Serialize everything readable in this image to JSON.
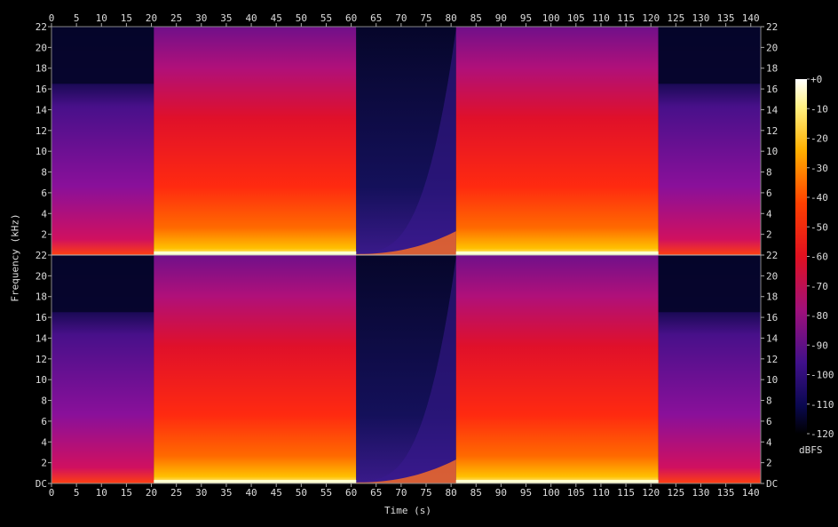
{
  "chart_data": {
    "type": "heatmap",
    "title": "",
    "xlabel": "Time (s)",
    "ylabel": "Frequency (kHz)",
    "xlim": [
      0,
      142
    ],
    "ylim": [
      0,
      22
    ],
    "x_ticks": [
      "0",
      "5",
      "10",
      "15",
      "20",
      "25",
      "30",
      "35",
      "40",
      "45",
      "50",
      "55",
      "60",
      "65",
      "70",
      "75",
      "80",
      "85",
      "90",
      "95",
      "100",
      "105",
      "110",
      "115",
      "120",
      "125",
      "130",
      "135",
      "140"
    ],
    "y_ticks_top": [
      "2",
      "4",
      "6",
      "8",
      "10",
      "12",
      "14",
      "16",
      "18",
      "20",
      "22"
    ],
    "y_ticks_bottom": [
      "DC",
      "2",
      "4",
      "6",
      "8",
      "10",
      "12",
      "14",
      "16",
      "18",
      "20",
      "22"
    ],
    "channels": 2,
    "colorbar": {
      "unit": "dBFS",
      "range": [
        -120,
        0
      ],
      "ticks": [
        "+0",
        "-10",
        "-20",
        "-30",
        "-40",
        "-50",
        "-60",
        "-70",
        "-80",
        "-90",
        "-100",
        "-110",
        "-120"
      ]
    },
    "segments": [
      {
        "start": 0,
        "end": 20.5,
        "character": "quiet, lowpass ~16.5 kHz"
      },
      {
        "start": 20.5,
        "end": 61,
        "character": "loud, full band"
      },
      {
        "start": 61,
        "end": 81,
        "character": "rising sweep, quiet"
      },
      {
        "start": 81,
        "end": 121.5,
        "character": "loud, full band"
      },
      {
        "start": 121.5,
        "end": 142,
        "character": "quiet, lowpass ~16.5 kHz"
      }
    ]
  }
}
